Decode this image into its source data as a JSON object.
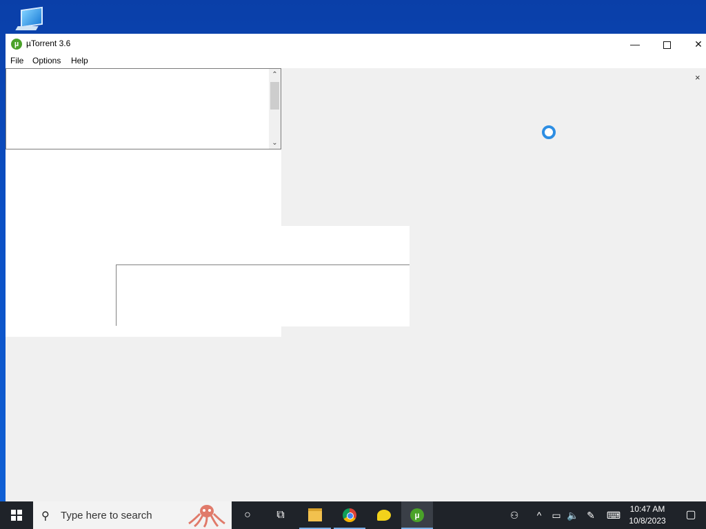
{
  "window": {
    "title": "µTorrent 3.6",
    "logo_glyph": "µ",
    "controls": {
      "minimize": "—",
      "maximize": "",
      "close": "✕"
    }
  },
  "menu": {
    "items": [
      "File",
      "Options",
      "Help"
    ]
  },
  "listbox": {
    "scroll_up": "⌃",
    "scroll_down": "⌄"
  },
  "sidebar": {
    "close": "×"
  },
  "taskbar": {
    "search_placeholder": "Type here to search",
    "clock_time": "10:47 AM",
    "clock_date": "10/8/2023",
    "icons": [
      "cortana-icon",
      "task-view-icon",
      "file-explorer-icon",
      "chrome-icon",
      "chat-icon",
      "utorrent-icon"
    ]
  },
  "tray": {
    "people": "⚇",
    "chevron": "^",
    "network": "▭",
    "volume": "🔈",
    "pen": "✎",
    "keyboard": "⌨",
    "notifications": "▢"
  },
  "colors": {
    "accent": "#4aa229",
    "spinner": "#2d8ee3",
    "taskbar": "#1f2329"
  }
}
